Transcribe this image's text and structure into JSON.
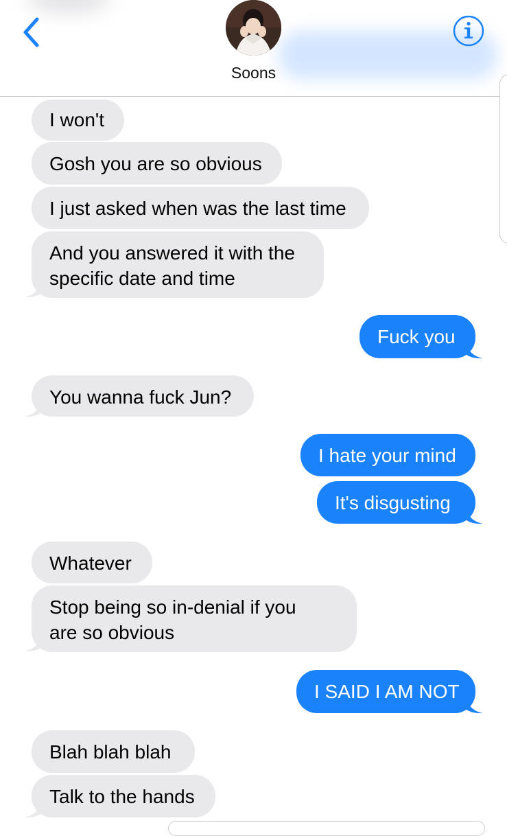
{
  "header": {
    "contact_name": "Soons",
    "back_icon": "chevron-left-icon",
    "info_icon": "info-circle-icon",
    "accent_color": "#1a82fb"
  },
  "messages": [
    {
      "dir": "in",
      "text": "I won't"
    },
    {
      "dir": "in",
      "text": "Gosh you are so obvious"
    },
    {
      "dir": "in",
      "text": "I just asked when was the last time"
    },
    {
      "dir": "in",
      "text": "And you answered it with the specific date and time",
      "lines": [
        "And you answered it with the",
        "specific date and time"
      ]
    },
    {
      "dir": "out",
      "text": "Fuck you"
    },
    {
      "dir": "in",
      "text": "You wanna fuck Jun?"
    },
    {
      "dir": "out",
      "text": "I hate your mind"
    },
    {
      "dir": "out",
      "text": "It's disgusting"
    },
    {
      "dir": "in",
      "text": "Whatever"
    },
    {
      "dir": "in",
      "text": "Stop being so in-denial if you are so obvious",
      "lines": [
        "Stop being so in-denial if you",
        "are so obvious"
      ]
    },
    {
      "dir": "out",
      "text": "I SAID I AM NOT"
    },
    {
      "dir": "in",
      "text": "Blah blah blah"
    },
    {
      "dir": "in",
      "text": "Talk to the hands"
    }
  ],
  "colors": {
    "incoming_bubble": "#e9e9eb",
    "outgoing_bubble": "#1a82fb"
  }
}
